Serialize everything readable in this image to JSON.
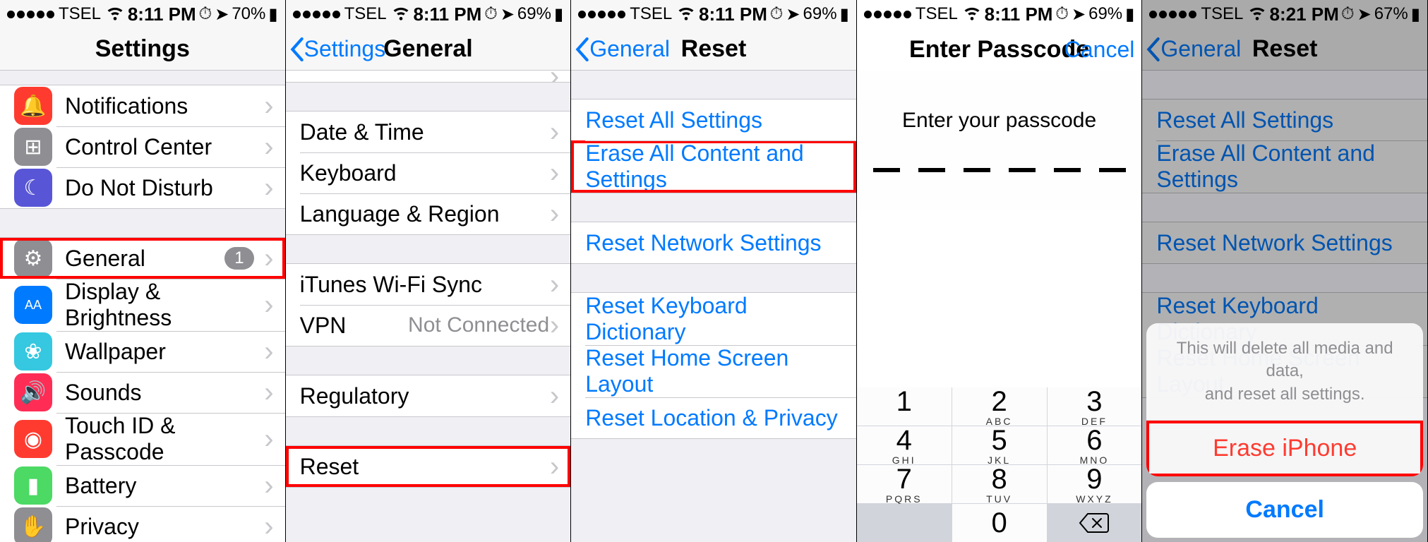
{
  "s1": {
    "status": {
      "carrier": "TSEL",
      "time": "8:11 PM",
      "battery": "70%"
    },
    "title": "Settings",
    "rows1": [
      {
        "icon": "🔔",
        "bg": "#ff3b30",
        "label": "Notifications",
        "name": "notifications"
      },
      {
        "icon": "⊞",
        "bg": "#8e8e93",
        "label": "Control Center",
        "name": "control-center"
      },
      {
        "icon": "☾",
        "bg": "#5856d6",
        "label": "Do Not Disturb",
        "name": "dnd"
      }
    ],
    "rows2": [
      {
        "icon": "⚙",
        "bg": "#8e8e93",
        "label": "General",
        "name": "general",
        "badge": "1",
        "highlight": true
      },
      {
        "icon": "AA",
        "bg": "#007aff",
        "label": "Display & Brightness",
        "name": "display"
      },
      {
        "icon": "❀",
        "bg": "#35c8e0",
        "label": "Wallpaper",
        "name": "wallpaper"
      },
      {
        "icon": "🔊",
        "bg": "#ff2d55",
        "label": "Sounds",
        "name": "sounds"
      },
      {
        "icon": "◉",
        "bg": "#ff3b30",
        "label": "Touch ID & Passcode",
        "name": "touchid"
      },
      {
        "icon": "▮",
        "bg": "#4cd964",
        "label": "Battery",
        "name": "battery"
      },
      {
        "icon": "✋",
        "bg": "#8e8e93",
        "label": "Privacy",
        "name": "privacy"
      }
    ]
  },
  "s2": {
    "status": {
      "carrier": "TSEL",
      "time": "8:11 PM",
      "battery": "69%"
    },
    "back": "Settings",
    "title": "General",
    "rows1": [
      {
        "label": "Date & Time",
        "name": "date-time"
      },
      {
        "label": "Keyboard",
        "name": "keyboard"
      },
      {
        "label": "Language & Region",
        "name": "language"
      }
    ],
    "rows2": [
      {
        "label": "iTunes Wi-Fi Sync",
        "name": "itunes-wifi"
      },
      {
        "label": "VPN",
        "name": "vpn",
        "detail": "Not Connected"
      }
    ],
    "rows3": [
      {
        "label": "Regulatory",
        "name": "regulatory"
      }
    ],
    "rows4": [
      {
        "label": "Reset",
        "name": "reset",
        "highlight": true
      }
    ]
  },
  "s3": {
    "status": {
      "carrier": "TSEL",
      "time": "8:11 PM",
      "battery": "69%"
    },
    "back": "General",
    "title": "Reset",
    "g1": [
      {
        "label": "Reset All Settings",
        "name": "reset-all"
      },
      {
        "label": "Erase All Content and Settings",
        "name": "erase-all",
        "highlight": true
      }
    ],
    "g2": [
      {
        "label": "Reset Network Settings",
        "name": "reset-network"
      }
    ],
    "g3": [
      {
        "label": "Reset Keyboard Dictionary",
        "name": "reset-keyboard"
      },
      {
        "label": "Reset Home Screen Layout",
        "name": "reset-home"
      },
      {
        "label": "Reset Location & Privacy",
        "name": "reset-location"
      }
    ]
  },
  "s4": {
    "status": {
      "carrier": "TSEL",
      "time": "8:11 PM",
      "battery": "69%"
    },
    "title": "Enter Passcode",
    "cancel": "Cancel",
    "prompt": "Enter your passcode",
    "keys": [
      {
        "n": "1",
        "s": ""
      },
      {
        "n": "2",
        "s": "ABC"
      },
      {
        "n": "3",
        "s": "DEF"
      },
      {
        "n": "4",
        "s": "GHI"
      },
      {
        "n": "5",
        "s": "JKL"
      },
      {
        "n": "6",
        "s": "MNO"
      },
      {
        "n": "7",
        "s": "PQRS"
      },
      {
        "n": "8",
        "s": "TUV"
      },
      {
        "n": "9",
        "s": "WXYZ"
      }
    ]
  },
  "s5": {
    "status": {
      "carrier": "TSEL",
      "time": "8:21 PM",
      "battery": "67%"
    },
    "back": "General",
    "title": "Reset",
    "g1": [
      {
        "label": "Reset All Settings",
        "name": "reset-all"
      },
      {
        "label": "Erase All Content and Settings",
        "name": "erase-all"
      }
    ],
    "g2": [
      {
        "label": "Reset Network Settings",
        "name": "reset-network"
      }
    ],
    "g3": [
      {
        "label": "Reset Keyboard Dictionary",
        "name": "reset-keyboard"
      },
      {
        "label": "Reset Home Screen Layout",
        "name": "reset-home"
      }
    ],
    "sheet": {
      "msg": "This will delete all media and data,\nand reset all settings.",
      "erase": "Erase iPhone",
      "cancel": "Cancel"
    }
  }
}
